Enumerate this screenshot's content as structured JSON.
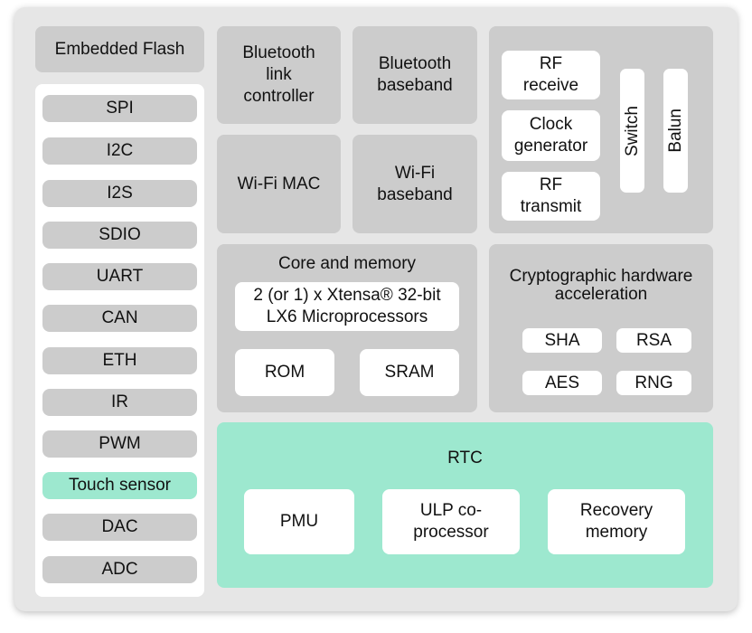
{
  "flash": "Embedded Flash",
  "peripherals": [
    "SPI",
    "I2C",
    "I2S",
    "SDIO",
    "UART",
    "CAN",
    "ETH",
    "IR",
    "PWM",
    "Touch sensor",
    "DAC",
    "ADC"
  ],
  "bluetooth": {
    "link": "Bluetooth link controller",
    "baseband": "Bluetooth baseband"
  },
  "wifi": {
    "mac": "Wi-Fi MAC",
    "baseband": "Wi-Fi baseband"
  },
  "rf": {
    "receive": "RF receive",
    "clock": "Clock generator",
    "transmit": "RF transmit",
    "switch": "Switch",
    "balun": "Balun"
  },
  "core": {
    "title": "Core and memory",
    "cpu": "2 (or 1) x Xtensa® 32-bit LX6 Microprocessors",
    "rom": "ROM",
    "sram": "SRAM"
  },
  "crypto": {
    "title": "Cryptographic hardware acceleration",
    "sha": "SHA",
    "rsa": "RSA",
    "aes": "AES",
    "rng": "RNG"
  },
  "rtc": {
    "title": "RTC",
    "pmu": "PMU",
    "ulp": "ULP co-processor",
    "recovery": "Recovery memory"
  },
  "colors": {
    "background": "#e6e6e6",
    "block": "#cccccc",
    "inner": "#ffffff",
    "rtc": "#9de8cf"
  }
}
